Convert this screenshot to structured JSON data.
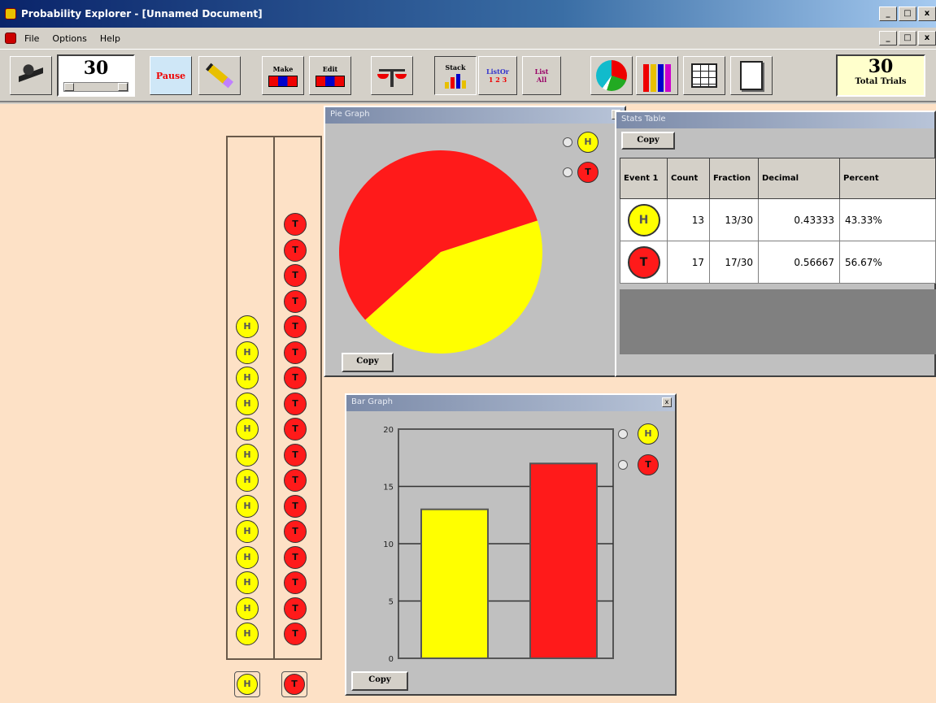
{
  "window": {
    "title": "Probability Explorer - [Unnamed Document]"
  },
  "menu": {
    "items": [
      "File",
      "Options",
      "Help"
    ]
  },
  "toolbar": {
    "trials_value": "30",
    "pause_label": "Pause",
    "make_label": "Make",
    "edit_label": "Edit",
    "stack_label": "Stack",
    "list123_label": "ListOr",
    "list123_sub": "1 2 3",
    "listall_label": "List",
    "listall_sub": "All",
    "total_value": "30",
    "total_label": "Total Trials"
  },
  "outcomes": [
    {
      "symbol": "H",
      "color": "#ffff00",
      "count": "13"
    },
    {
      "symbol": "T",
      "color": "#ff1a1a",
      "count": "17"
    }
  ],
  "pie_panel": {
    "title": "Pie Graph",
    "copy_label": "Copy"
  },
  "bar_panel": {
    "title": "Bar Graph",
    "copy_label": "Copy"
  },
  "stats_panel": {
    "title": "Stats Table",
    "copy_label": "Copy",
    "headers": [
      "Event 1",
      "Count",
      "Fraction",
      "Decimal",
      "Percent"
    ],
    "rows": [
      {
        "event": "H",
        "count": "13",
        "fraction": "13/30",
        "decimal": "0.43333",
        "percent": "43.33%"
      },
      {
        "event": "T",
        "count": "17",
        "fraction": "17/30",
        "decimal": "0.56667",
        "percent": "56.67%"
      }
    ]
  },
  "chart_data": [
    {
      "type": "pie",
      "categories": [
        "H",
        "T"
      ],
      "values": [
        13,
        17
      ],
      "colors": [
        "#ffff00",
        "#ff1a1a"
      ]
    },
    {
      "type": "bar",
      "categories": [
        "H",
        "T"
      ],
      "values": [
        13,
        17
      ],
      "colors": [
        "#ffff00",
        "#ff1a1a"
      ],
      "ylim": [
        0,
        20
      ],
      "yticks": [
        "0",
        "5",
        "10",
        "15",
        "20"
      ],
      "grid": true
    }
  ]
}
